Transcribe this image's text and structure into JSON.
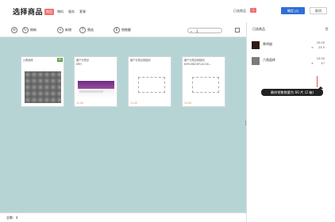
{
  "header": {
    "title": "选择商品",
    "tabs": [
      {
        "label": "商品",
        "active": true
      },
      {
        "label": "物料",
        "active": false
      },
      {
        "label": "服务",
        "active": false
      },
      {
        "label": "套餐",
        "active": false
      }
    ],
    "selected_label": "已选商品",
    "selected_count": "2",
    "confirm_label": "确定 (2)",
    "cancel_label": "取消"
  },
  "toolbar": {
    "refresh_label": "刷新",
    "add_label": "新增",
    "filter_label": "筛选",
    "sales_label": "销售额",
    "search_value": "1"
  },
  "cards": [
    {
      "title": "六角面砖",
      "subtitle": "",
      "price": "",
      "badge": "60"
    },
    {
      "title": "客户分类目",
      "subtitle": "KRFJ",
      "price": "11.00",
      "badge": ""
    },
    {
      "title": "客户分类目测描测",
      "subtitle": "",
      "price": "11.00",
      "badge": ""
    },
    {
      "title": "客户分类目测描测",
      "subtitle": "KHFLMDGHFLGCGK...",
      "price": "11.00",
      "badge": ""
    }
  ],
  "side": {
    "title": "已选商品",
    "items": [
      {
        "name": "厚鸡翅",
        "price": "20.00",
        "qty": "23.5"
      },
      {
        "name": "六角面砖",
        "price": "24.00",
        "qty": "47"
      }
    ],
    "tooltip": "最终销售数量为 60 片 (2 箱)"
  },
  "footer": {
    "total_label": "总数：4"
  },
  "colors": {
    "accent": "#2f6fd6",
    "tab_active": "#f07070",
    "canvas_bg": "#b7d4d5",
    "badge": "#5aa54a"
  }
}
